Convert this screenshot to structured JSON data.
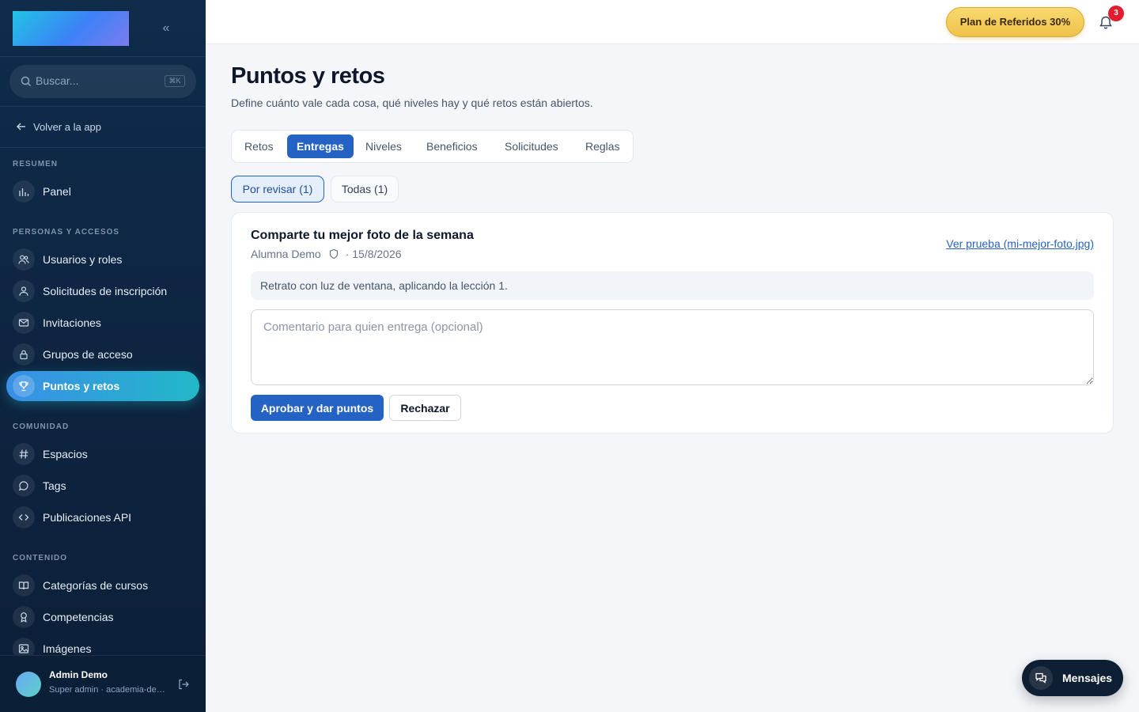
{
  "sidebar": {
    "collapse_icon": "«",
    "search": {
      "placeholder": "Buscar...",
      "shortcut": "⌘K"
    },
    "back_label": "Volver a la app",
    "sections": {
      "resumen": "RESUMEN",
      "personas": "PERSONAS Y ACCESOS",
      "comunidad": "COMUNIDAD",
      "contenido": "CONTENIDO"
    },
    "items": {
      "panel": "Panel",
      "usuarios": "Usuarios y roles",
      "solicitudes": "Solicitudes de inscripción",
      "invitaciones": "Invitaciones",
      "grupos": "Grupos de acceso",
      "puntos": "Puntos y retos",
      "espacios": "Espacios",
      "tags": "Tags",
      "publicaciones": "Publicaciones API",
      "categorias": "Categorías de cursos",
      "competencias": "Competencias",
      "imagenes": "Imágenes"
    },
    "user": {
      "name": "Admin Demo",
      "role": "Super admin · academia-demo"
    }
  },
  "topbar": {
    "referral": "Plan de Referidos 30%",
    "notifications": "3"
  },
  "main": {
    "title": "Puntos y retos",
    "subtitle": "Define cuánto vale cada cosa, qué niveles hay y qué retos están abiertos.",
    "tabs": [
      "Retos",
      "Entregas",
      "Niveles",
      "Beneficios",
      "Solicitudes",
      "Reglas"
    ],
    "filters": {
      "pending": "Por revisar (1)",
      "all": "Todas (1)"
    },
    "submission": {
      "title": "Comparte tu mejor foto de la semana",
      "author": "Alumna Demo",
      "date": "· 15/8/2026",
      "proof_link": "Ver prueba (mi-mejor-foto.jpg)",
      "note": "Retrato con luz de ventana, aplicando la lección 1.",
      "comment_placeholder": "Comentario para quien entrega (opcional)",
      "approve": "Aprobar y dar puntos",
      "reject": "Rechazar"
    }
  },
  "messages_label": "Mensajes",
  "colors": {
    "primary": "#2463c4",
    "sidebar": "#0d2440",
    "active_gradient_start": "#3a8fe6",
    "active_gradient_end": "#22b8c8",
    "badge": "#e11d2e"
  }
}
